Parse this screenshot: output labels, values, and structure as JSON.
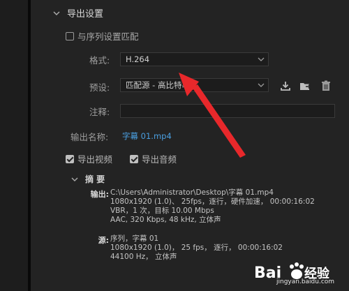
{
  "export_settings": {
    "title": "导出设置",
    "match_sequence_label": "与序列设置匹配",
    "format_label": "格式:",
    "format_value": "H.264",
    "preset_label": "预设:",
    "preset_value": "匹配源 - 高比特率",
    "comment_label": "注释:",
    "comment_value": "",
    "output_name_label": "输出名称:",
    "output_name_value": "字幕 01.mp4",
    "export_video_label": "导出视频",
    "export_audio_label": "导出音频",
    "export_video_checked": true,
    "export_audio_checked": true,
    "match_sequence_checked": false
  },
  "icons": {
    "section_toggle": "chevron-down-icon",
    "save_preset": "download-icon",
    "import_preset": "folder-import-icon",
    "delete_preset": "trash-icon"
  },
  "summary": {
    "title": "摘 要",
    "output_label": "输出:",
    "output_lines": [
      "C:\\Users\\Administrator\\Desktop\\字幕 01.mp4",
      "1080x1920 (1.0)、 25fps，逐行，硬件加速， 00:00:16:02",
      "VBR，1 次，目标 10.00 Mbps",
      "AAC, 320 Kbps, 48  kHz, 立体声"
    ],
    "source_label": "源:",
    "source_lines": [
      "序列，字幕 01",
      "1080x1920 (1.0)， 25 fps， 逐行， 00:00:16:02",
      "44100 Hz， 立体声"
    ]
  },
  "watermark": {
    "brand": "Bai",
    "brand_suffix": "经验",
    "url": "jingyan.baidu.com"
  },
  "colors": {
    "accent_link": "#4a9fe0",
    "annotation_arrow": "#e8282b"
  }
}
